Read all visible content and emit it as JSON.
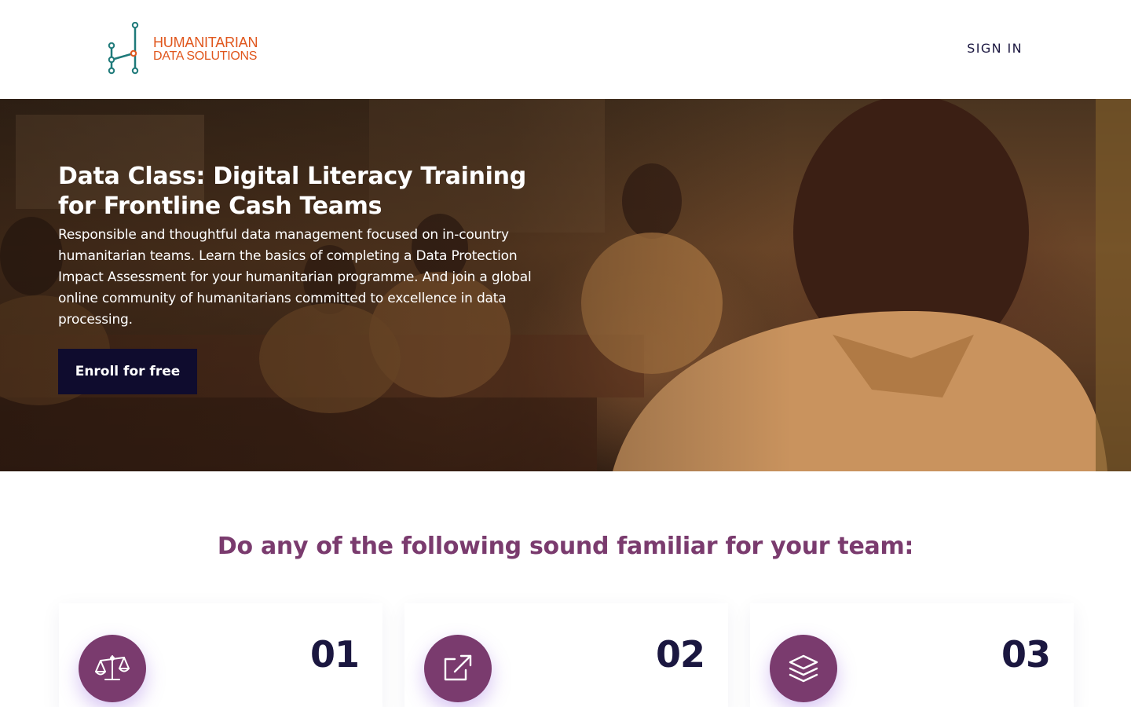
{
  "header": {
    "logo_line1": "HUMANITARIAN",
    "logo_line2": "DATA SOLUTIONS",
    "signin_label": "SIGN IN"
  },
  "hero": {
    "title_line1": "Data Class: Digital Literacy Training",
    "title_line2": "for Frontline Cash Teams",
    "description": "Responsible and thoughtful data management focused on in-country humanitarian teams. Learn the basics of completing a Data Protection Impact Assessment for your humanitarian programme. And join a global online community of humanitarians committed to excellence in data processing.",
    "cta_label": "Enroll for free"
  },
  "section": {
    "title": "Do any of the following sound familiar for your team:"
  },
  "cards": [
    {
      "number": "01",
      "icon": "scale-icon"
    },
    {
      "number": "02",
      "icon": "external-link-icon"
    },
    {
      "number": "03",
      "icon": "layers-icon"
    }
  ],
  "colors": {
    "brand_orange": "#e0561c",
    "brand_teal": "#1f7a7a",
    "accent_purple": "#7a3b6e",
    "navy": "#0f0c2e"
  }
}
